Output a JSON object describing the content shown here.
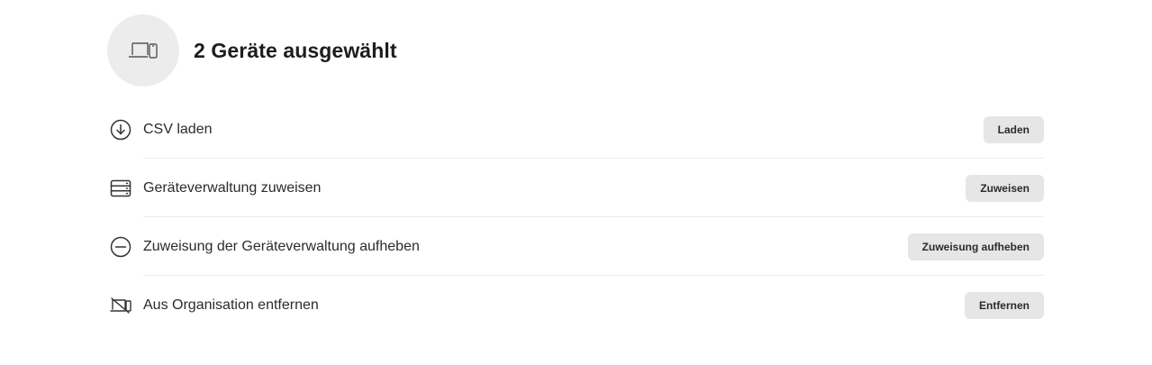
{
  "header": {
    "title": "2 Geräte ausgewählt",
    "icon": "devices-icon"
  },
  "actions": [
    {
      "icon": "download-circle-icon",
      "label": "CSV laden",
      "button": "Laden"
    },
    {
      "icon": "server-stack-icon",
      "label": "Geräteverwaltung zuweisen",
      "button": "Zuweisen"
    },
    {
      "icon": "minus-circle-icon",
      "label": "Zuweisung der Geräteverwaltung aufheben",
      "button": "Zuweisung aufheben"
    },
    {
      "icon": "devices-remove-icon",
      "label": "Aus Organisation entfernen",
      "button": "Entfernen"
    }
  ],
  "colors": {
    "button_bg": "#e6e6e6",
    "avatar_bg": "#ececec",
    "divider": "#ececec",
    "text": "#1d1d1f"
  }
}
